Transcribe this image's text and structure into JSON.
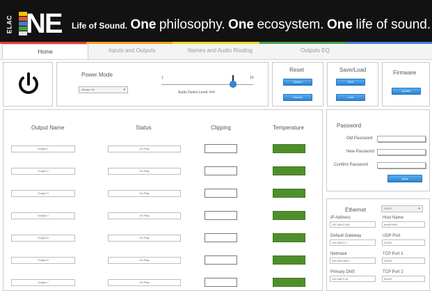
{
  "header": {
    "brand_small": "ELAC",
    "brand_word": "NE",
    "tagline_intro": "Life of Sound.",
    "tagline_one_1": "One",
    "tagline_text_1": "philosophy.",
    "tagline_one_2": "One",
    "tagline_text_2": "ecosystem.",
    "tagline_one_3": "One",
    "tagline_text_3": "life of sound.",
    "bar_colors": [
      "#f2c400",
      "#e5542b",
      "#3d7fd0",
      "#4a9e3b",
      "#e0e0e0"
    ]
  },
  "stripe_colors": [
    "#e63b2e",
    "#f29b1d",
    "#f2d51d",
    "#3fa34d",
    "#3d7fd0"
  ],
  "tabs": [
    "Home",
    "Inputs and Outputs",
    "Names and Audio Routing",
    "Outputs EQ"
  ],
  "power": {
    "mode_label": "Power Mode",
    "mode_value": "Always On",
    "slider_min": "1",
    "slider_max": "10",
    "slider_value": 8,
    "detect_label": "Audio Detect Level: ###"
  },
  "reset": {
    "title": "Reset",
    "btn1": "System",
    "btn2": "Factory"
  },
  "save_load": {
    "title": "Save/Load",
    "btn1": "Save",
    "btn2": "Load"
  },
  "firmware": {
    "title": "Firmware",
    "btn": "Update"
  },
  "outputs": {
    "col_name": "Output Name",
    "col_status": "Status",
    "col_clipping": "Clipping",
    "col_temp": "Temperature",
    "rows": [
      {
        "name": "Output 1",
        "status": "On Play"
      },
      {
        "name": "Output 2",
        "status": "On Play"
      },
      {
        "name": "Output 3",
        "status": "On Play"
      },
      {
        "name": "Output 4",
        "status": "On Play"
      },
      {
        "name": "Output 5",
        "status": "On Play"
      },
      {
        "name": "Output 6",
        "status": "On Play"
      },
      {
        "name": "Output 7",
        "status": "On Play"
      }
    ]
  },
  "password": {
    "title": "Password",
    "old_label": "Old Password",
    "new_label": "New Password",
    "confirm_label": "Confirm Password",
    "apply": "Apply"
  },
  "ethernet": {
    "title": "Ethernet",
    "mode": "DHCP",
    "ip_label": "IP Address",
    "ip_value": "192.168.0.169",
    "host_label": "Host Name",
    "host_value": "ampP1600",
    "gw_label": "Default Gateway",
    "gw_value": "192.168.0.1",
    "udp_label": "UDP Port",
    "udp_value": "49152",
    "mask_label": "Netmask",
    "mask_value": "255.255.255.0",
    "tcp1_label": "TCP Port 1",
    "tcp1_value": "49153",
    "dns_label": "Primary DNS",
    "dns_value": "192.168.0.15",
    "tcp2_label": "TCP Port 2",
    "tcp2_value": "49154"
  }
}
